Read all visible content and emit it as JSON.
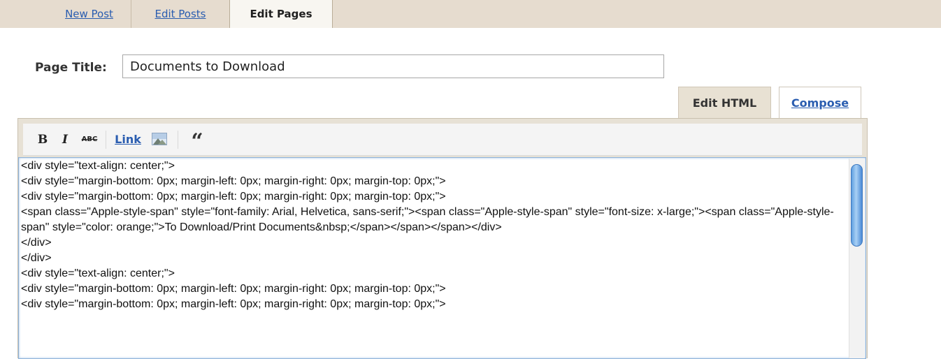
{
  "top_tabs": {
    "new_post": "New Post",
    "edit_posts": "Edit Posts",
    "edit_pages": "Edit Pages"
  },
  "page_title": {
    "label": "Page Title:",
    "value": "Documents to Download"
  },
  "mode_tabs": {
    "edit_html": "Edit HTML",
    "compose": "Compose"
  },
  "toolbar": {
    "bold": "B",
    "italic": "I",
    "strikethrough": "ABC",
    "link": "Link",
    "image_icon": "image-icon",
    "quote": "“"
  },
  "editor": {
    "lines": [
      "<div style=\"text-align: center;\">",
      "<div style=\"margin-bottom: 0px; margin-left: 0px; margin-right: 0px; margin-top: 0px;\">",
      "<div style=\"margin-bottom: 0px; margin-left: 0px; margin-right: 0px; margin-top: 0px;\">",
      "<span class=\"Apple-style-span\" style=\"font-family: Arial, Helvetica, sans-serif;\"><span class=\"Apple-style-span\" style=\"font-size: x-large;\"><span class=\"Apple-style-span\" style=\"color: orange;\">To Download/Print Documents&nbsp;</span></span></span></div>",
      "</div>",
      "</div>",
      "<div style=\"text-align: center;\">",
      "<div style=\"margin-bottom: 0px; margin-left: 0px; margin-right: 0px; margin-top: 0px;\">",
      "<div style=\"margin-bottom: 0px; margin-left: 0px; margin-right: 0px; margin-top: 0px;\">"
    ]
  },
  "colors": {
    "tab_bar": "#e6dccf",
    "link": "#2a5db0",
    "editor_frame": "#e7e1d5"
  }
}
